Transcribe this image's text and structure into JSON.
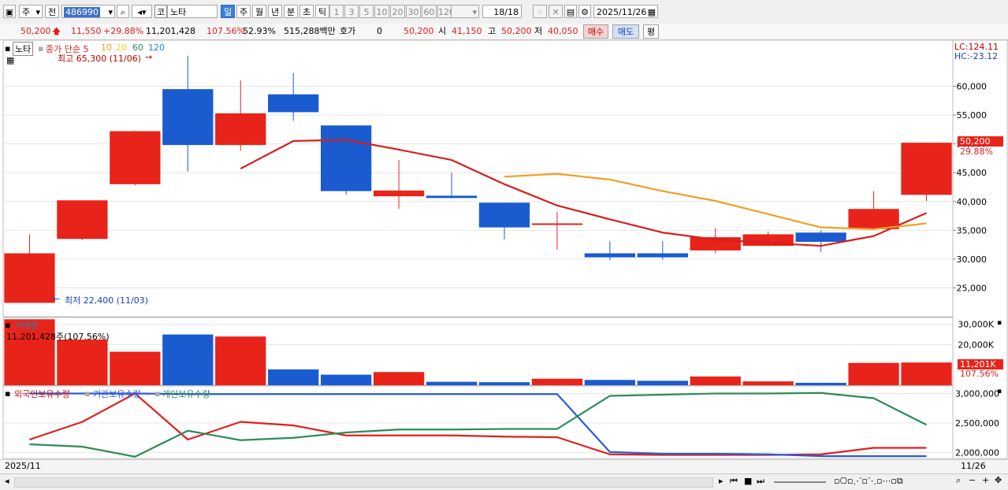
{
  "toolbar": {
    "period_label": "주",
    "prev_label": "전",
    "code": "486990",
    "market_badge": "코",
    "stock_name": "노타",
    "tabs": [
      "일",
      "주",
      "월",
      "년",
      "분",
      "초",
      "틱"
    ],
    "selected_tab": "일",
    "intervals": [
      "1",
      "3",
      "5",
      "10",
      "20",
      "30",
      "60",
      "120"
    ],
    "count": "18/18",
    "date": "2025/11/26"
  },
  "quote": {
    "price": "50,200",
    "change": "11,550",
    "change_pct": "+29.88%",
    "volume": "11,201,428",
    "volume_ratio": "107.56%",
    "turnover": "52.93%",
    "amount": "515,288백만",
    "hoga_label": "호가",
    "hoga_value": "0",
    "hoga_price": "50,200",
    "open_label": "시",
    "open": "41,150",
    "high_label": "고",
    "high": "50,200",
    "low_label": "저",
    "low": "40,050",
    "buy_label": "매수",
    "sell_label": "매도",
    "flat_label": "평"
  },
  "price_legend": {
    "name": "노타",
    "ma_label": "종가 단순 5",
    "ma_periods": [
      "10",
      "20",
      "60",
      "120"
    ],
    "high_note": "최고 65,300 (11/06)",
    "low_note": "최저 22,400 (11/03)",
    "lc": "LC:124.11",
    "hc": "HC:-23.12",
    "last_price": "50,200",
    "last_pct": "29.88%"
  },
  "volume_legend": {
    "title": "거래량",
    "value": "11,201,428주(107.56%)",
    "last_value": "11,201K",
    "last_pct": "107.56%"
  },
  "holding_legend": {
    "foreign": "외국인보유수량",
    "institution": "기관보유수량",
    "individual": "개인보유수량"
  },
  "dates": {
    "start": "2025/11",
    "end": "11/26"
  },
  "colors": {
    "up": "#e8231a",
    "down": "#1a5bd0",
    "ma5": "#d81e1e",
    "ma20": "#f0a020",
    "green": "#2e8b57",
    "foreign": "#e02020",
    "inst": "#2a5bd8"
  },
  "chart_data": [
    {
      "type": "candlestick",
      "name": "price",
      "ylim": [
        20000,
        68000
      ],
      "yticks": [
        25000,
        30000,
        35000,
        40000,
        45000,
        50000,
        55000,
        60000
      ],
      "candles": [
        {
          "o": 22400,
          "h": 34300,
          "l": 22400,
          "c": 31000,
          "dir": "up"
        },
        {
          "o": 33500,
          "h": 40200,
          "l": 33300,
          "c": 40200,
          "dir": "up"
        },
        {
          "o": 43000,
          "h": 52300,
          "l": 42800,
          "c": 52200,
          "dir": "up"
        },
        {
          "o": 59500,
          "h": 65300,
          "l": 45200,
          "c": 49800,
          "dir": "down"
        },
        {
          "o": 49800,
          "h": 61000,
          "l": 48800,
          "c": 55300,
          "dir": "up"
        },
        {
          "o": 58600,
          "h": 62300,
          "l": 54000,
          "c": 55500,
          "dir": "down"
        },
        {
          "o": 53200,
          "h": 53200,
          "l": 41200,
          "c": 41800,
          "dir": "down"
        },
        {
          "o": 40900,
          "h": 47200,
          "l": 38700,
          "c": 41900,
          "dir": "up"
        },
        {
          "o": 41000,
          "h": 45000,
          "l": 40500,
          "c": 40600,
          "dir": "down"
        },
        {
          "o": 39800,
          "h": 39800,
          "l": 33400,
          "c": 35500,
          "dir": "down"
        },
        {
          "o": 36200,
          "h": 38200,
          "l": 31700,
          "c": 36200,
          "dir": "up"
        },
        {
          "o": 31000,
          "h": 33100,
          "l": 29800,
          "c": 30300,
          "dir": "down"
        },
        {
          "o": 31000,
          "h": 33100,
          "l": 29900,
          "c": 30300,
          "dir": "down"
        },
        {
          "o": 31500,
          "h": 35400,
          "l": 31000,
          "c": 33800,
          "dir": "up"
        },
        {
          "o": 32300,
          "h": 34800,
          "l": 32200,
          "c": 34300,
          "dir": "up"
        },
        {
          "o": 34600,
          "h": 35000,
          "l": 31200,
          "c": 33000,
          "dir": "down"
        },
        {
          "o": 35200,
          "h": 41800,
          "l": 35000,
          "c": 38700,
          "dir": "up"
        },
        {
          "o": 41150,
          "h": 50200,
          "l": 40050,
          "c": 50200,
          "dir": "up"
        }
      ],
      "ma5": [
        null,
        null,
        null,
        null,
        45700,
        50500,
        50700,
        49000,
        47200,
        43000,
        39300,
        36900,
        34600,
        33400,
        32800,
        32300,
        34000,
        38000
      ],
      "ma20": [
        null,
        null,
        null,
        null,
        null,
        null,
        null,
        null,
        null,
        44300,
        44800,
        43800,
        41800,
        40100,
        37800,
        35500,
        35200,
        36200
      ]
    },
    {
      "type": "bar",
      "name": "volume",
      "ylim": [
        0,
        33000
      ],
      "yticks": [
        20000,
        30000
      ],
      "ytick_labels": [
        "20,000K",
        "30,000K"
      ],
      "values": [
        32500,
        22500,
        16500,
        25000,
        24000,
        7800,
        5200,
        6500,
        1700,
        1500,
        3200,
        2600,
        2200,
        4300,
        1900,
        1200,
        11000,
        11201
      ],
      "dir": [
        "up",
        "up",
        "up",
        "down",
        "up",
        "down",
        "down",
        "up",
        "down",
        "down",
        "up",
        "down",
        "down",
        "up",
        "up",
        "down",
        "up",
        "up"
      ]
    },
    {
      "type": "line",
      "name": "holdings",
      "ylim": [
        1900000,
        3100000
      ],
      "yticks": [
        2000000,
        2500000,
        3000000
      ],
      "ytick_labels": [
        "2,000,000",
        "2,500,000",
        "3,000,000"
      ],
      "series": [
        {
          "name": "외국인보유수량",
          "values": [
            2220000,
            2520000,
            3000000,
            2220000,
            2520000,
            2460000,
            2290000,
            2290000,
            2290000,
            2270000,
            2260000,
            1970000,
            1960000,
            1960000,
            1960000,
            1970000,
            2080000,
            2080000
          ]
        },
        {
          "name": "기관보유수량",
          "values": [
            3000000,
            3000000,
            3000000,
            2990000,
            2990000,
            2990000,
            2990000,
            2990000,
            2990000,
            2990000,
            2990000,
            2010000,
            1980000,
            1980000,
            1970000,
            1940000,
            1940000,
            1940000
          ]
        },
        {
          "name": "개인보유수량",
          "values": [
            2140000,
            2100000,
            1930000,
            2370000,
            2210000,
            2250000,
            2340000,
            2390000,
            2390000,
            2400000,
            2400000,
            2960000,
            2980000,
            3000000,
            3000000,
            3010000,
            2920000,
            2470000
          ]
        }
      ]
    }
  ]
}
